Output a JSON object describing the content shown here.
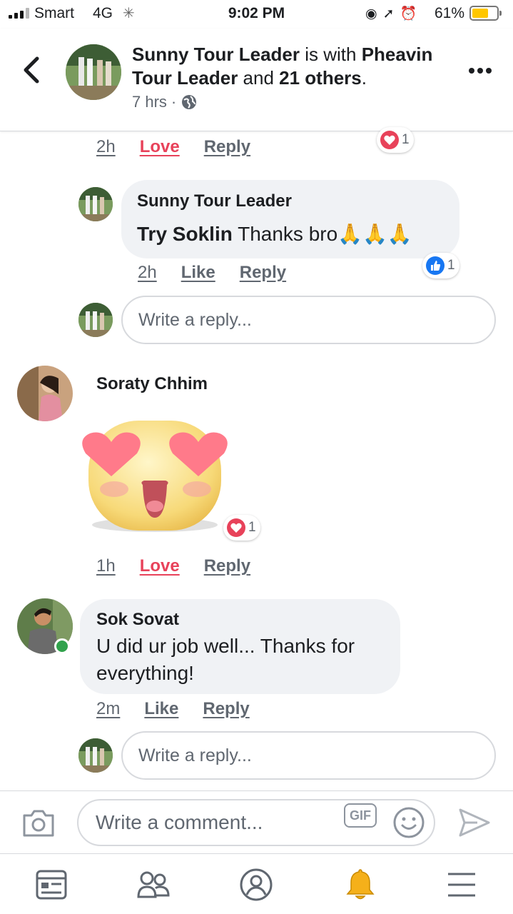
{
  "status_bar": {
    "carrier": "Smart",
    "network": "4G",
    "time": "9:02 PM",
    "battery_percent": "61%",
    "battery_level": 0.61,
    "battery_color": "#ffc700"
  },
  "header": {
    "author": "Sunny Tour Leader",
    "is_with_text": " is with ",
    "tagged": "Pheavin Tour Leader",
    "and_text": " and ",
    "others": "21 others",
    "period": ".",
    "time": "7 hrs",
    "separator": "·",
    "privacy_icon": "globe-icon",
    "back_icon": "chevron-left-icon",
    "more_icon": "more-dots-icon"
  },
  "comments": [
    {
      "id": "prev-reply",
      "time": "2h",
      "action": "Love",
      "reply_label": "Reply",
      "reaction": {
        "icon": "heart-icon",
        "count": "1"
      }
    },
    {
      "id": "sunny-reply",
      "author": "Sunny Tour Leader",
      "mention": "Try Soklin",
      "text": " Thanks bro",
      "emoji": "🙏🙏🙏",
      "time": "2h",
      "action": "Like",
      "reply_label": "Reply",
      "reaction": {
        "icon": "like-icon",
        "count": "1"
      }
    },
    {
      "id": "soraty",
      "author": "Soraty Chhim",
      "sticker": "heart-eyes-sticker",
      "time": "1h",
      "action": "Love",
      "reply_label": "Reply",
      "reaction": {
        "icon": "heart-icon",
        "count": "1"
      }
    },
    {
      "id": "sok-sovat",
      "author": "Sok Sovat",
      "text_line1": "U did ur job well... Thanks for",
      "text_line2": "everything!",
      "time": "2m",
      "action": "Like",
      "reply_label": "Reply",
      "online": true
    }
  ],
  "reply_placeholder": "Write a reply...",
  "composer": {
    "placeholder": "Write a comment...",
    "gif_label": "GIF",
    "camera_icon": "camera-icon",
    "emoji_icon": "smiley-icon",
    "send_icon": "send-icon"
  },
  "tabs": [
    {
      "name": "news-feed",
      "icon": "news-feed-icon"
    },
    {
      "name": "friends",
      "icon": "friends-icon"
    },
    {
      "name": "profile",
      "icon": "profile-icon"
    },
    {
      "name": "notifications",
      "icon": "bell-icon",
      "active": true
    },
    {
      "name": "menu",
      "icon": "menu-icon"
    }
  ],
  "colors": {
    "love": "#e8425a",
    "like_blue": "#1877f2",
    "bubble": "#f0f2f5",
    "muted": "#606770",
    "bell_active": "#f5b01a",
    "online": "#31a24c"
  }
}
